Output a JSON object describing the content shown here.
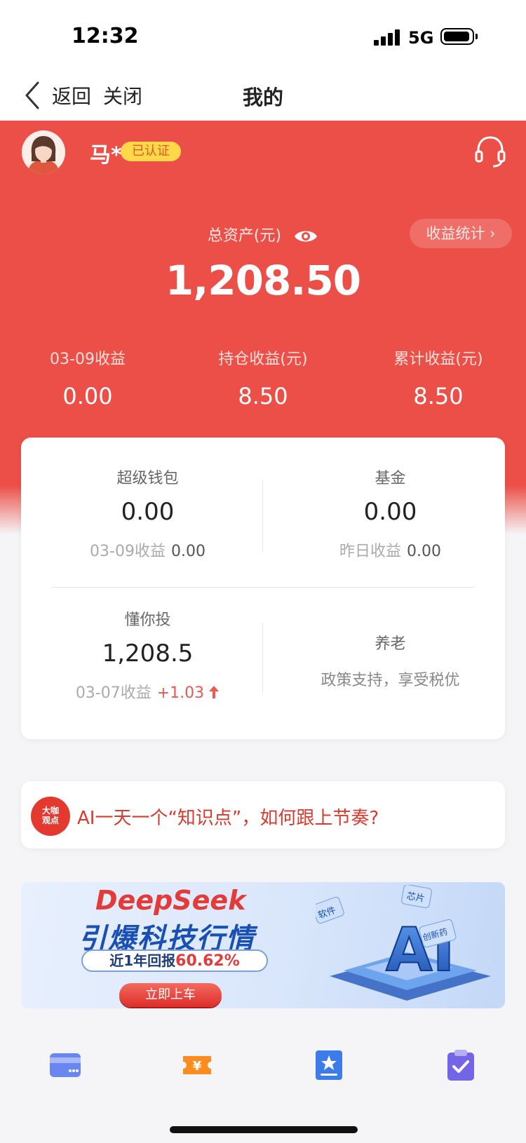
{
  "status_bar": {
    "time": "12:32",
    "network": "5G"
  },
  "nav": {
    "back_label": "返回",
    "close_label": "关闭",
    "title": "我的"
  },
  "profile": {
    "name": "马*",
    "verified_label": "已认证"
  },
  "assets": {
    "total_label": "总资产(元)",
    "total_value": "1,208.50",
    "stats_button": "收益统计 ›",
    "earnings": [
      {
        "label": "03-09收益",
        "value": "0.00"
      },
      {
        "label": "持仓收益(元)",
        "value": "8.50"
      },
      {
        "label": "累计收益(元)",
        "value": "8.50"
      }
    ]
  },
  "products": {
    "wallet": {
      "title": "超级钱包",
      "amount": "0.00",
      "sub_label": "03-09收益",
      "sub_value": "0.00"
    },
    "fund": {
      "title": "基金",
      "amount": "0.00",
      "sub_label": "昨日收益",
      "sub_value": "0.00"
    },
    "advisor": {
      "title": "懂你投",
      "amount": "1,208.5",
      "sub_label": "03-07收益",
      "sub_value": "+1.03"
    },
    "pension": {
      "title": "养老",
      "desc": "政策支持，享受税优"
    }
  },
  "tip": {
    "badge_line1": "大咖",
    "badge_line2": "观点",
    "text": "AI一天一个“知识点”，如何跟上节奏?"
  },
  "promo": {
    "brand": "DeepSeek",
    "headline": "引爆科技行情",
    "return_label": "近1年回报",
    "return_value": "60.62%",
    "cta": "立即上车",
    "ai_text": "AI",
    "tags": [
      "软件",
      "芯片",
      "创新药"
    ]
  },
  "bottom_icons": [
    "card-icon",
    "coupon-icon",
    "star-document-icon",
    "clipboard-check-icon"
  ],
  "colors": {
    "primary_red": "#ec4f47",
    "gold_badge": "#ffd84a",
    "brand_blue": "#1a4fb4"
  }
}
